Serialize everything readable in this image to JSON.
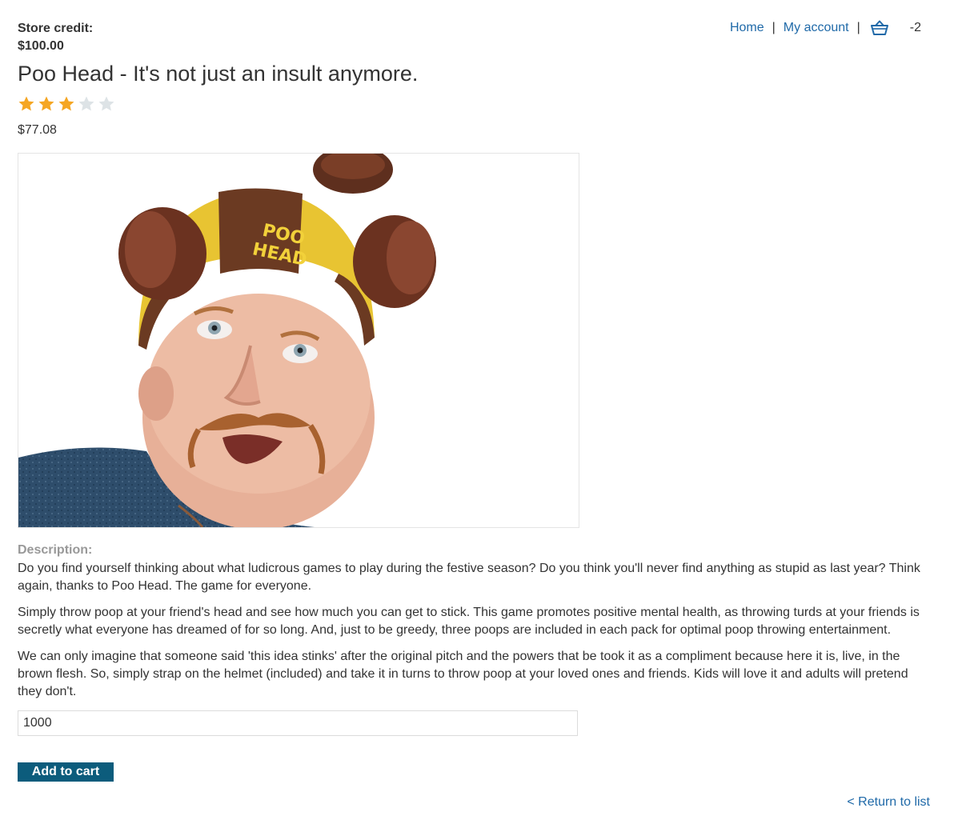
{
  "header": {
    "store_credit_label": "Store credit:",
    "store_credit_value": "$100.00",
    "nav": {
      "home": "Home",
      "separator": "|",
      "my_account": "My account",
      "cart_count": "-2"
    }
  },
  "product": {
    "title": "Poo Head - It's not just an insult anymore.",
    "rating": {
      "value": 3,
      "max": 5,
      "filled_color": "#f5a623",
      "empty_color": "#dde3e6"
    },
    "price": "$77.08",
    "image_icon": "product-photo",
    "hat_text_line1": "POO",
    "hat_text_line2": "HEAD",
    "description_label": "Description:",
    "description": [
      "Do you find yourself thinking about what ludicrous games to play during the festive season? Do you think you'll never find anything as stupid as last year? Think again, thanks to Poo Head. The game for everyone.",
      "Simply throw poop at your friend's head and see how much you can get to stick. This game promotes positive mental health, as throwing turds at your friends is secretly what everyone has dreamed of for so long. And, just to be greedy, three poops are included in each pack for optimal poop throwing entertainment.",
      "We can only imagine that someone said 'this idea stinks' after the original pitch and the powers that be took it as a compliment because here it is, live, in the brown flesh. So, simply strap on the helmet (included) and take it in turns to throw poop at your loved ones and friends. Kids will love it and adults will pretend they don't."
    ]
  },
  "form": {
    "quantity_value": "1000",
    "add_to_cart_label": "Add to cart"
  },
  "footer": {
    "return_link": "< Return to list"
  },
  "colors": {
    "link": "#1f69a8",
    "button": "#0c5c7c"
  }
}
